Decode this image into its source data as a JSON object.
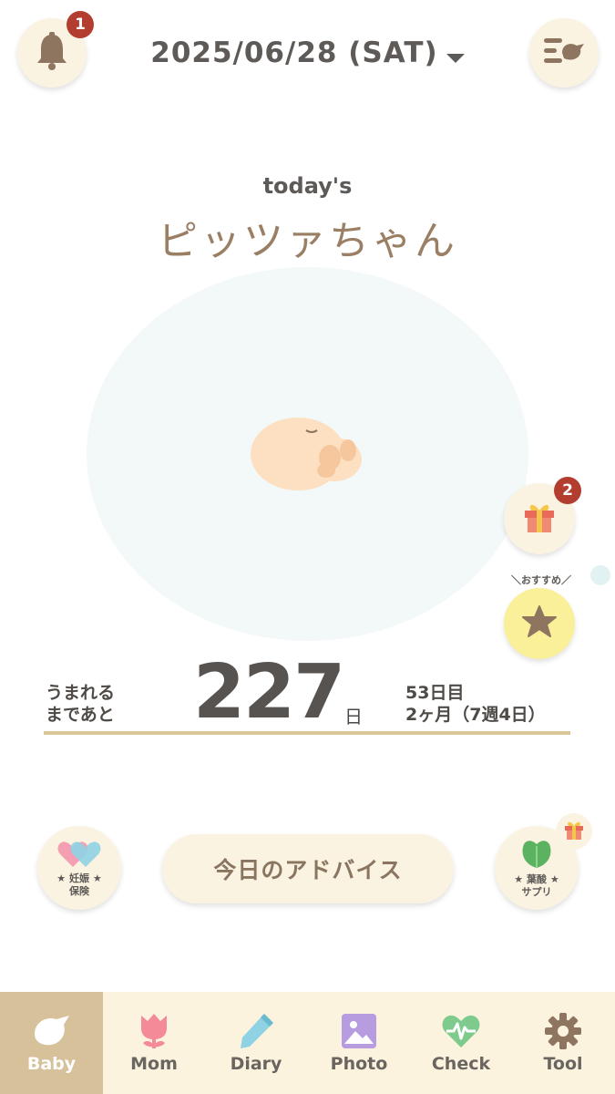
{
  "header": {
    "bell_badge": "1",
    "date": "2025/06/28 (SAT)"
  },
  "main": {
    "todays_label": "today's",
    "baby_name": "ピッツァちゃん",
    "until_birth_line1": "うまれる",
    "until_birth_line2": "まであと",
    "days_remaining": "227",
    "days_unit": "日",
    "day_count_line1": "53日目",
    "day_count_line2": "2ヶ月（7週4日）",
    "advice_button": "今日のアドバイス"
  },
  "side": {
    "gift_badge": "2",
    "recommend_label": "＼おすすめ／"
  },
  "insurance": {
    "line1": "★ 妊娠 ★",
    "line2": "保険"
  },
  "supplement": {
    "line1": "★ 葉酸 ★",
    "line2": "サプリ"
  },
  "nav": {
    "items": [
      {
        "label": "Baby",
        "icon": "bird-icon"
      },
      {
        "label": "Mom",
        "icon": "tulip-icon"
      },
      {
        "label": "Diary",
        "icon": "pencil-icon"
      },
      {
        "label": "Photo",
        "icon": "photo-icon"
      },
      {
        "label": "Check",
        "icon": "heartbeat-icon"
      },
      {
        "label": "Tool",
        "icon": "gear-icon"
      }
    ]
  },
  "colors": {
    "accent_beige": "#fbf3e1",
    "active_tab": "#d7c19a",
    "badge_red": "#b33d2f",
    "divider": "#d8c697",
    "name_brown": "#9a7f65"
  }
}
